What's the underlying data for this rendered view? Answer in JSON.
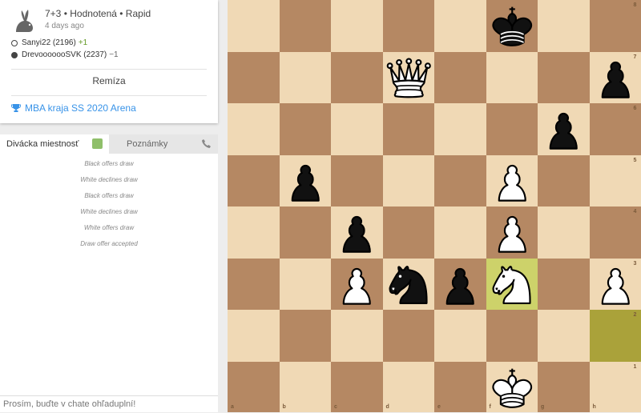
{
  "game": {
    "title": "7+3 • Hodnotená • Rapid",
    "time_ago": "4 days ago",
    "white_player": "Sanyi22 (2196)",
    "white_diff": "+1",
    "black_player": "DrevooooooSVK (2237)",
    "black_diff": "−1",
    "result": "Remíza",
    "tournament": "MBA kraja SS 2020 Arena",
    "game_icon": "rabbit-icon",
    "tournament_icon": "trophy-icon"
  },
  "chat": {
    "tab_spectators": "Divácka miestnosť",
    "tab_notes": "Poznámky",
    "messages": [
      "Black offers draw",
      "White declines draw",
      "Black offers draw",
      "White declines draw",
      "White offers draw",
      "Draw offer accepted"
    ],
    "input_placeholder": "Prosím, buďte v chate ohľaduplní!"
  },
  "board": {
    "files": [
      "a",
      "b",
      "c",
      "d",
      "e",
      "f",
      "g",
      "h"
    ],
    "ranks": [
      "8",
      "7",
      "6",
      "5",
      "4",
      "3",
      "2",
      "1"
    ],
    "light_color": "#f0d9b5",
    "dark_color": "#b58863",
    "highlight_squares": [
      "f3",
      "h2"
    ],
    "pieces": [
      {
        "square": "f8",
        "type": "king",
        "color": "black"
      },
      {
        "square": "d7",
        "type": "queen",
        "color": "white"
      },
      {
        "square": "h7",
        "type": "pawn",
        "color": "black"
      },
      {
        "square": "g6",
        "type": "pawn",
        "color": "black"
      },
      {
        "square": "b5",
        "type": "pawn",
        "color": "black"
      },
      {
        "square": "f5",
        "type": "pawn",
        "color": "white"
      },
      {
        "square": "c4",
        "type": "pawn",
        "color": "black"
      },
      {
        "square": "f4",
        "type": "pawn",
        "color": "white"
      },
      {
        "square": "c3",
        "type": "pawn",
        "color": "white"
      },
      {
        "square": "d3",
        "type": "knight",
        "color": "black"
      },
      {
        "square": "e3",
        "type": "pawn",
        "color": "black"
      },
      {
        "square": "f3",
        "type": "knight",
        "color": "white"
      },
      {
        "square": "h3",
        "type": "pawn",
        "color": "white"
      },
      {
        "square": "f1",
        "type": "king",
        "color": "white"
      }
    ]
  }
}
